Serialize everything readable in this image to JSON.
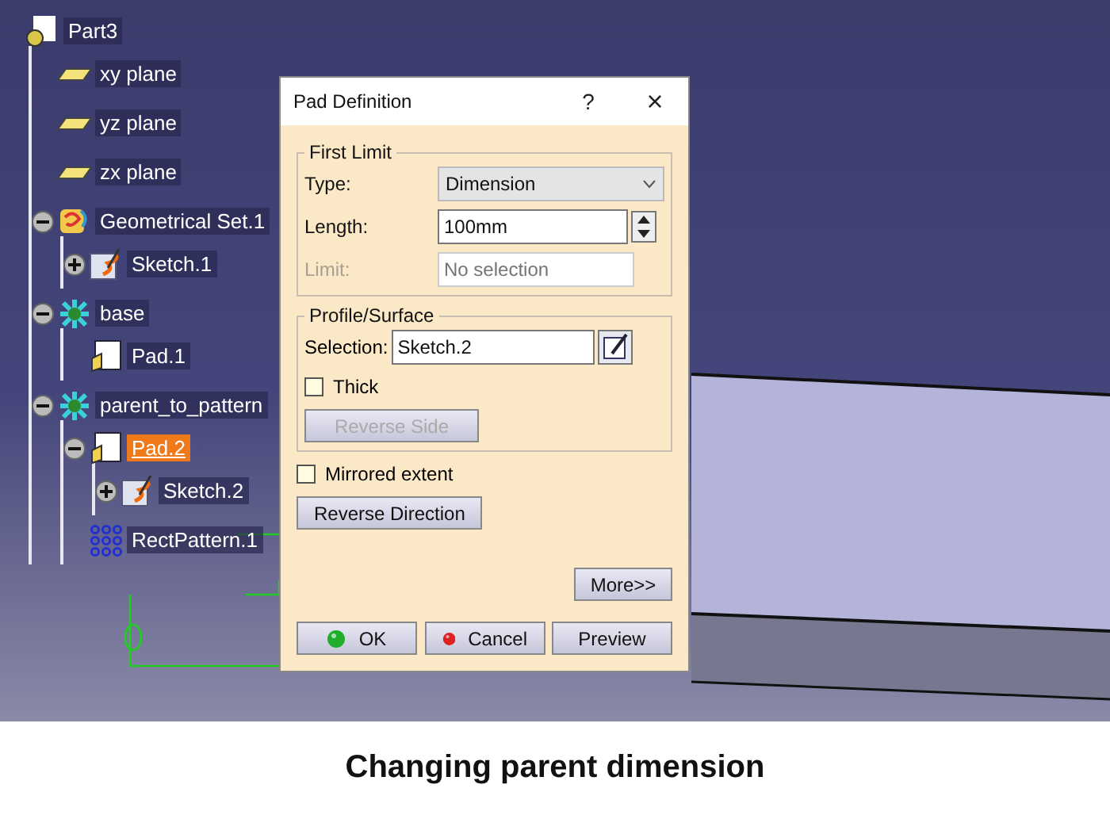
{
  "tree": {
    "label": "Part3",
    "kind": "part",
    "selected": false,
    "children": [
      {
        "label": "xy plane",
        "kind": "plane",
        "selected": false
      },
      {
        "label": "yz plane",
        "kind": "plane",
        "selected": false
      },
      {
        "label": "zx plane",
        "kind": "plane",
        "selected": false
      },
      {
        "label": "Geometrical Set.1",
        "kind": "geoset",
        "selected": false,
        "expanded": true,
        "children": [
          {
            "label": "Sketch.1",
            "kind": "sketch",
            "selected": false,
            "expanded": false
          }
        ]
      },
      {
        "label": "base",
        "kind": "body",
        "selected": false,
        "expanded": true,
        "children": [
          {
            "label": "Pad.1",
            "kind": "pad",
            "selected": false
          }
        ]
      },
      {
        "label": "parent_to_pattern",
        "kind": "body",
        "selected": false,
        "expanded": true,
        "children": [
          {
            "label": "Pad.2",
            "kind": "pad",
            "selected": true,
            "expanded": true,
            "children": [
              {
                "label": "Sketch.2",
                "kind": "sketch",
                "selected": false,
                "expanded": false
              }
            ]
          },
          {
            "label": "RectPattern.1",
            "kind": "pattern",
            "selected": false
          }
        ]
      }
    ]
  },
  "dialog": {
    "title": "Pad Definition",
    "help": "?",
    "close": "×",
    "first_limit": {
      "title": "First Limit",
      "rows": [
        {
          "kind": "dropdown",
          "label": "Type:",
          "value": "Dimension",
          "disabled": false
        },
        {
          "kind": "spinner",
          "label": "Length:",
          "value": "100mm",
          "disabled": false
        },
        {
          "kind": "text",
          "label": "Limit:",
          "placeholder": "No selection",
          "disabled": true
        }
      ]
    },
    "profile": {
      "title": "Profile/Surface",
      "label": "Selection:",
      "value": "Sketch.2",
      "thick": {
        "label": "Thick",
        "checked": false
      },
      "reverse_side": {
        "label": "Reverse Side",
        "disabled": true
      }
    },
    "mirrored": {
      "label": "Mirrored extent",
      "checked": false
    },
    "reverse_direction": {
      "label": "Reverse Direction",
      "disabled": false
    },
    "more": "More>>",
    "buttons": [
      {
        "label": "OK",
        "kind": "ok"
      },
      {
        "label": "Cancel",
        "kind": "cancel"
      },
      {
        "label": "Preview",
        "kind": "plain"
      }
    ]
  },
  "caption": "Changing parent dimension"
}
